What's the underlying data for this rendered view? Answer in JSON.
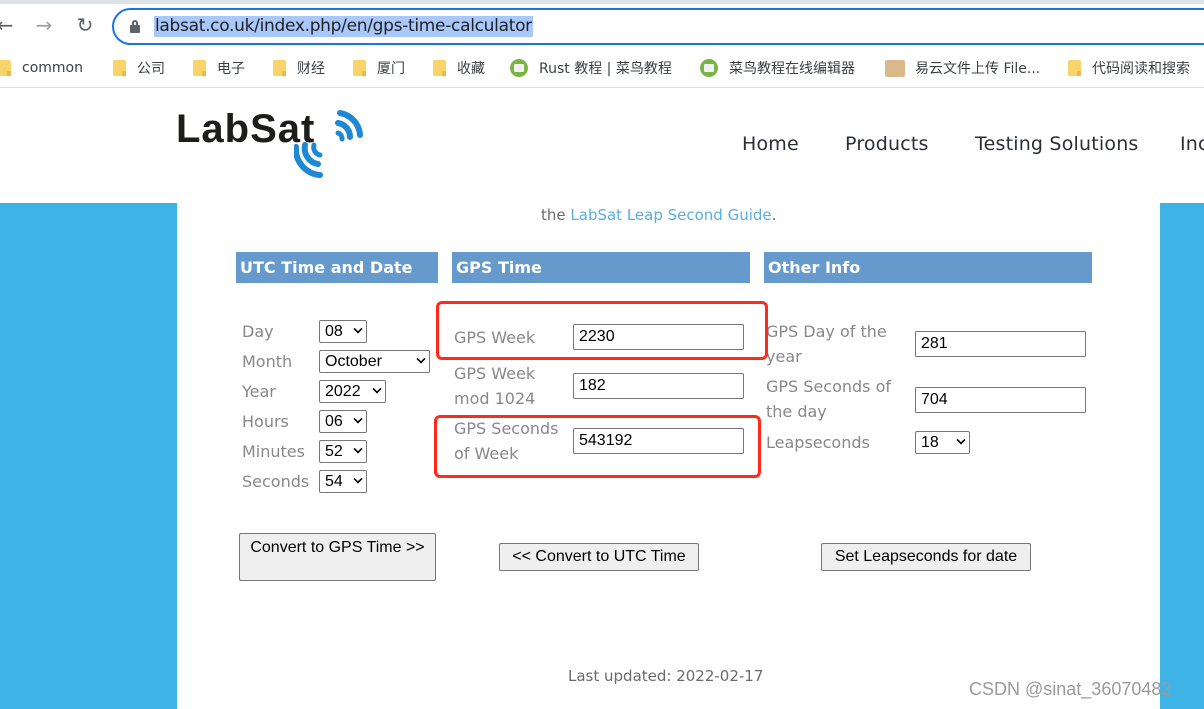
{
  "browser": {
    "url": "labsat.co.uk/index.php/en/gps-time-calculator",
    "nav": {
      "back": "←",
      "forward": "→",
      "reload": "↻"
    },
    "bookmarks": [
      {
        "label": "common",
        "icon": "folder-icon"
      },
      {
        "label": "公司",
        "icon": "folder-icon"
      },
      {
        "label": "电子",
        "icon": "folder-icon"
      },
      {
        "label": "财经",
        "icon": "folder-icon"
      },
      {
        "label": "厦门",
        "icon": "folder-icon"
      },
      {
        "label": "收藏",
        "icon": "folder-icon"
      },
      {
        "label": "Rust 教程 | 菜鸟教程",
        "icon": "runoob-icon"
      },
      {
        "label": "菜鸟教程在线编辑器",
        "icon": "runoob-icon"
      },
      {
        "label": "易云文件上传 File...",
        "icon": "ftp-folder-icon"
      },
      {
        "label": "代码阅读和搜索",
        "icon": "folder-icon"
      }
    ]
  },
  "site": {
    "logo": "LabSat",
    "nav": [
      "Home",
      "Products",
      "Testing Solutions",
      "Inc"
    ],
    "intro_prefix": "the ",
    "intro_link": "LabSat Leap Second Guide",
    "intro_suffix": "."
  },
  "colors": {
    "accent_blue": "#3db4e5",
    "header_blue": "#6699cc",
    "highlight_red": "#ff2a1d",
    "link": "#5aaee0"
  },
  "utc": {
    "heading": "UTC Time and Date",
    "fields": [
      {
        "label": "Day",
        "value": "08"
      },
      {
        "label": "Month",
        "value": "October"
      },
      {
        "label": "Year",
        "value": "2022"
      },
      {
        "label": "Hours",
        "value": "06"
      },
      {
        "label": "Minutes",
        "value": "52"
      },
      {
        "label": "Seconds",
        "value": "54"
      }
    ],
    "button": "Convert to GPS Time >>"
  },
  "gps": {
    "heading": "GPS Time",
    "fields": [
      {
        "label": "GPS Week",
        "value": "2230"
      },
      {
        "label": "GPS Week mod 1024",
        "value": "182"
      },
      {
        "label": "GPS Seconds of Week",
        "value": "543192"
      }
    ],
    "button": "<< Convert to UTC Time"
  },
  "other": {
    "heading": "Other Info",
    "fields": [
      {
        "label": "GPS Day of the year",
        "value": "281"
      },
      {
        "label": "GPS Seconds of the day",
        "value": "704"
      },
      {
        "label": "Leapseconds",
        "value": "18"
      }
    ],
    "button": "Set Leapseconds for date"
  },
  "footer": {
    "last_updated": "Last updated: 2022-02-17"
  },
  "watermark": "CSDN @sinat_36070482"
}
